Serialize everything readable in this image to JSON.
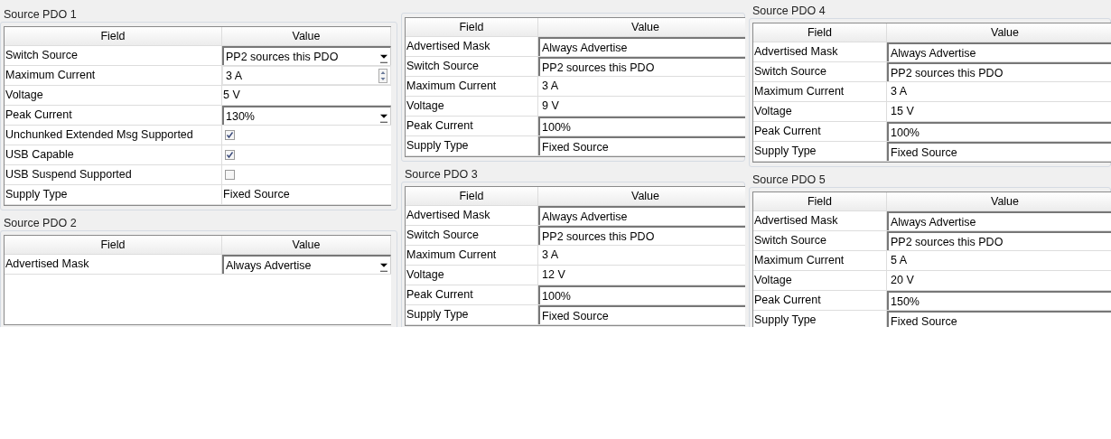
{
  "columns": [
    {
      "panels": [
        {
          "title": "Source PDO 1",
          "headers": [
            "Field",
            "Value"
          ],
          "rows": [
            {
              "field": "Switch Source",
              "kind": "combo",
              "value": "PP2 sources this PDO"
            },
            {
              "field": "Maximum Current",
              "kind": "spin",
              "value": "3 A"
            },
            {
              "field": "Voltage",
              "kind": "text",
              "value": "5 V"
            },
            {
              "field": "Peak Current",
              "kind": "combo",
              "value": "130%"
            },
            {
              "field": "Unchunked Extended Msg Supported",
              "kind": "checkbox",
              "checked": true
            },
            {
              "field": "USB Capable",
              "kind": "checkbox",
              "checked": true
            },
            {
              "field": "USB Suspend Supported",
              "kind": "checkbox",
              "checked": false
            },
            {
              "field": "Supply Type",
              "kind": "text",
              "value": "Fixed Source"
            }
          ]
        },
        {
          "title": "Source PDO 2",
          "headers": [
            "Field",
            "Value"
          ],
          "rows": [
            {
              "field": "Advertised Mask",
              "kind": "combo",
              "value": "Always Advertise"
            }
          ]
        }
      ]
    },
    {
      "panels": [
        {
          "headers": [
            "Field",
            "Value"
          ],
          "rows": [
            {
              "field": "Advertised Mask",
              "kind": "field",
              "value": "Always Advertise"
            },
            {
              "field": "Switch Source",
              "kind": "field",
              "value": "PP2 sources this PDO"
            },
            {
              "field": "Maximum Current",
              "kind": "text",
              "value": "3 A"
            },
            {
              "field": "Voltage",
              "kind": "text",
              "value": "9 V"
            },
            {
              "field": "Peak Current",
              "kind": "field",
              "value": "100%"
            },
            {
              "field": "Supply Type",
              "kind": "field",
              "value": "Fixed Source"
            }
          ]
        },
        {
          "title": "Source PDO 3",
          "headers": [
            "Field",
            "Value"
          ],
          "rows": [
            {
              "field": "Advertised Mask",
              "kind": "field",
              "value": "Always Advertise"
            },
            {
              "field": "Switch Source",
              "kind": "field",
              "value": "PP2 sources this PDO"
            },
            {
              "field": "Maximum Current",
              "kind": "text",
              "value": "3 A"
            },
            {
              "field": "Voltage",
              "kind": "text",
              "value": "12 V"
            },
            {
              "field": "Peak Current",
              "kind": "field",
              "value": "100%"
            },
            {
              "field": "Supply Type",
              "kind": "field",
              "value": "Fixed Source"
            }
          ]
        }
      ]
    },
    {
      "panels": [
        {
          "title": "Source PDO 4",
          "headers": [
            "Field",
            "Value"
          ],
          "rows": [
            {
              "field": "Advertised Mask",
              "kind": "field",
              "value": "Always Advertise"
            },
            {
              "field": "Switch Source",
              "kind": "field",
              "value": "PP2 sources this PDO"
            },
            {
              "field": "Maximum Current",
              "kind": "text",
              "value": "3 A"
            },
            {
              "field": "Voltage",
              "kind": "text",
              "value": "15 V"
            },
            {
              "field": "Peak Current",
              "kind": "field",
              "value": "100%"
            },
            {
              "field": "Supply Type",
              "kind": "field",
              "value": "Fixed Source"
            }
          ]
        },
        {
          "title": "Source PDO 5",
          "headers": [
            "Field",
            "Value"
          ],
          "rows": [
            {
              "field": "Advertised Mask",
              "kind": "field",
              "value": "Always Advertise"
            },
            {
              "field": "Switch Source",
              "kind": "field",
              "value": "PP2 sources this PDO"
            },
            {
              "field": "Maximum Current",
              "kind": "text",
              "value": "5 A"
            },
            {
              "field": "Voltage",
              "kind": "text",
              "value": "20 V"
            },
            {
              "field": "Peak Current",
              "kind": "field",
              "value": "150%"
            },
            {
              "field": "Supply Type",
              "kind": "field",
              "value": "Fixed Source"
            }
          ]
        }
      ]
    }
  ]
}
